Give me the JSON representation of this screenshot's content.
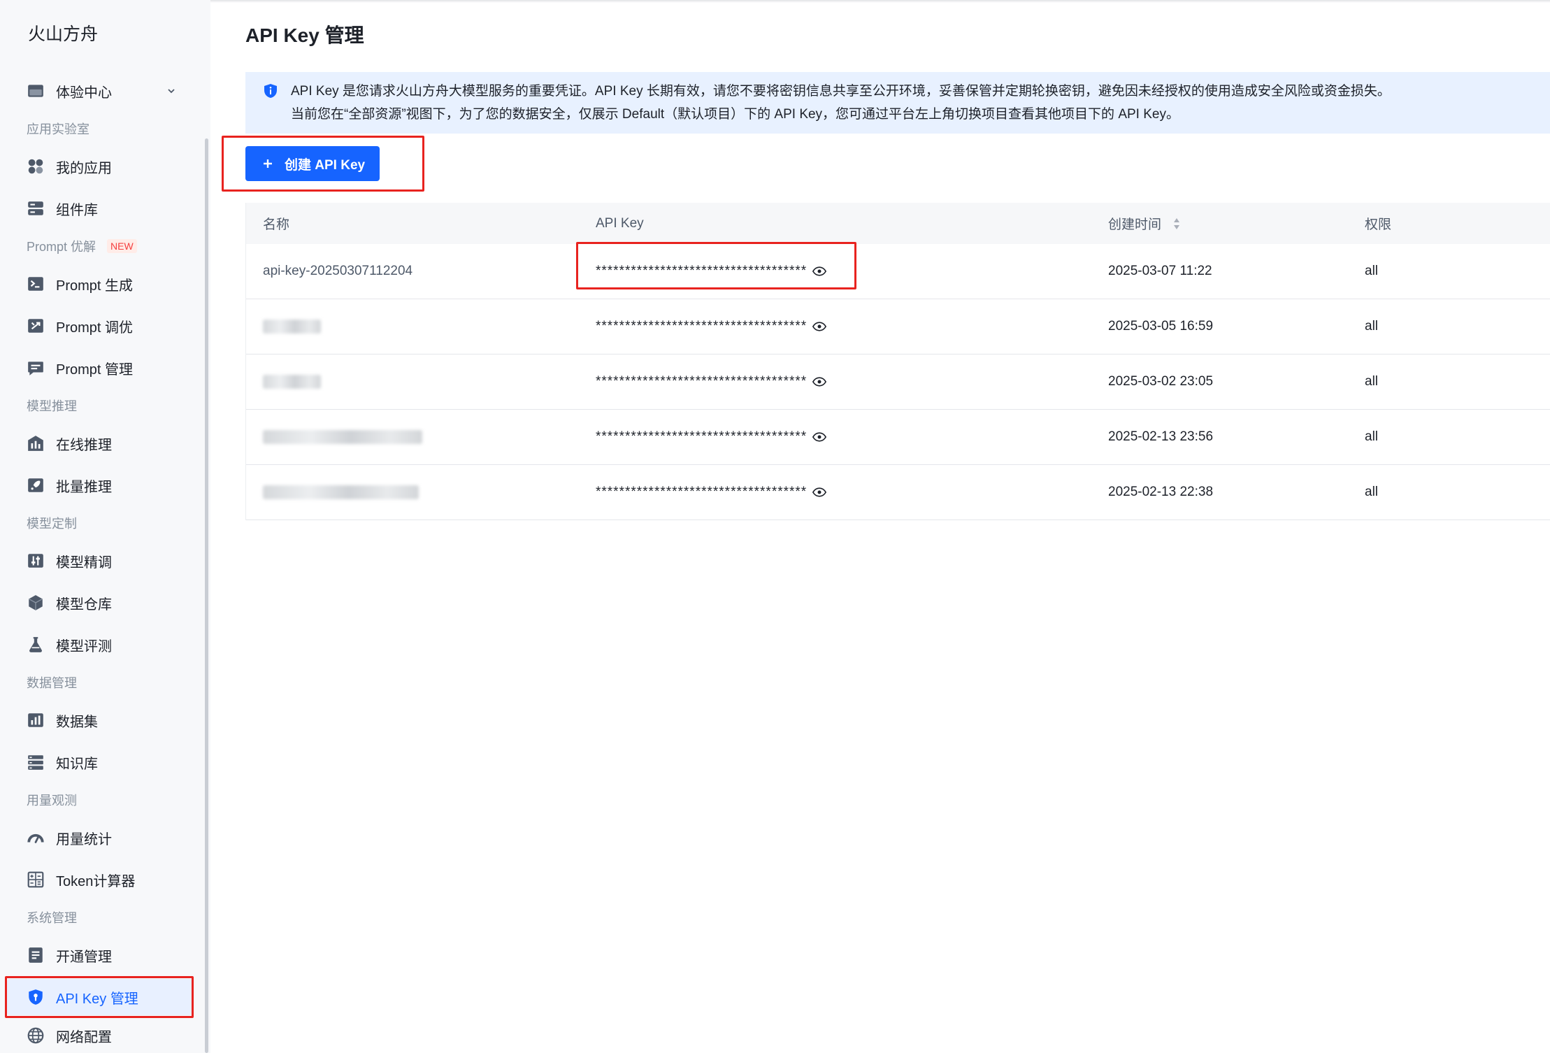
{
  "sidebar": {
    "title": "火山方舟",
    "entries": [
      {
        "label": "体验中心",
        "icon": "experience-center-icon",
        "expandable": true
      },
      {
        "section": "应用实验室"
      },
      {
        "label": "我的应用",
        "icon": "apps-icon"
      },
      {
        "label": "组件库",
        "icon": "component-library-icon"
      },
      {
        "section": "Prompt 优解",
        "badge": "NEW"
      },
      {
        "label": "Prompt 生成",
        "icon": "terminal-icon"
      },
      {
        "label": "Prompt 调优",
        "icon": "tune-icon"
      },
      {
        "label": "Prompt 管理",
        "icon": "message-list-icon"
      },
      {
        "section": "模型推理"
      },
      {
        "label": "在线推理",
        "icon": "inference-chart-icon"
      },
      {
        "label": "批量推理",
        "icon": "rocket-icon"
      },
      {
        "section": "模型定制"
      },
      {
        "label": "模型精调",
        "icon": "sliders-icon"
      },
      {
        "label": "模型仓库",
        "icon": "cube-icon"
      },
      {
        "label": "模型评测",
        "icon": "flask-icon"
      },
      {
        "section": "数据管理"
      },
      {
        "label": "数据集",
        "icon": "dataset-icon"
      },
      {
        "label": "知识库",
        "icon": "knowledge-base-icon"
      },
      {
        "section": "用量观测"
      },
      {
        "label": "用量统计",
        "icon": "gauge-icon"
      },
      {
        "label": "Token计算器",
        "icon": "calculator-icon"
      },
      {
        "section": "系统管理"
      },
      {
        "label": "开通管理",
        "icon": "document-icon"
      },
      {
        "label": "API Key 管理",
        "icon": "shield-key-icon",
        "active": true
      },
      {
        "label": "网络配置",
        "icon": "globe-icon"
      }
    ]
  },
  "page": {
    "title": "API Key 管理"
  },
  "notice": {
    "icon": "info-shield-icon",
    "line1": "API Key 是您请求火山方舟大模型服务的重要凭证。API Key 长期有效，请您不要将密钥信息共享至公开环境，妥善保管并定期轮换密钥，避免因未经授权的使用造成安全风险或资金损失。",
    "line2": "当前您在“全部资源”视图下，为了您的数据安全，仅展示 Default（默认项目）下的 API Key，您可通过平台左上角切换项目查看其他项目下的 API Key。"
  },
  "toolbar": {
    "create_label": "创建 API Key",
    "create_icon": "plus-icon"
  },
  "table": {
    "columns": [
      {
        "label": "名称"
      },
      {
        "label": "API Key"
      },
      {
        "label": "创建时间",
        "sortable": true,
        "sort_icon": "sort-icon"
      },
      {
        "label": "权限"
      }
    ],
    "key_toggle_icon": "eye-icon",
    "rows": [
      {
        "name": "api-key-20250307112204",
        "key": "************************************",
        "created": "2025-03-07 11:22",
        "permission": "all"
      },
      {
        "key": "************************************",
        "created": "2025-03-05 16:59",
        "permission": "all"
      },
      {
        "key": "************************************",
        "created": "2025-03-02 23:05",
        "permission": "all"
      },
      {
        "key": "************************************",
        "created": "2025-02-13 23:56",
        "permission": "all"
      },
      {
        "key": "************************************",
        "created": "2025-02-13 22:38",
        "permission": "all"
      }
    ]
  },
  "colors": {
    "accent": "#1664ff",
    "active_bg": "#e8f0ff",
    "notice_bg": "#e8f1ff",
    "annotation_red": "#e8231f",
    "badge_text": "#f53f3f",
    "badge_bg": "#ffece8",
    "icon": "#4e5969"
  }
}
